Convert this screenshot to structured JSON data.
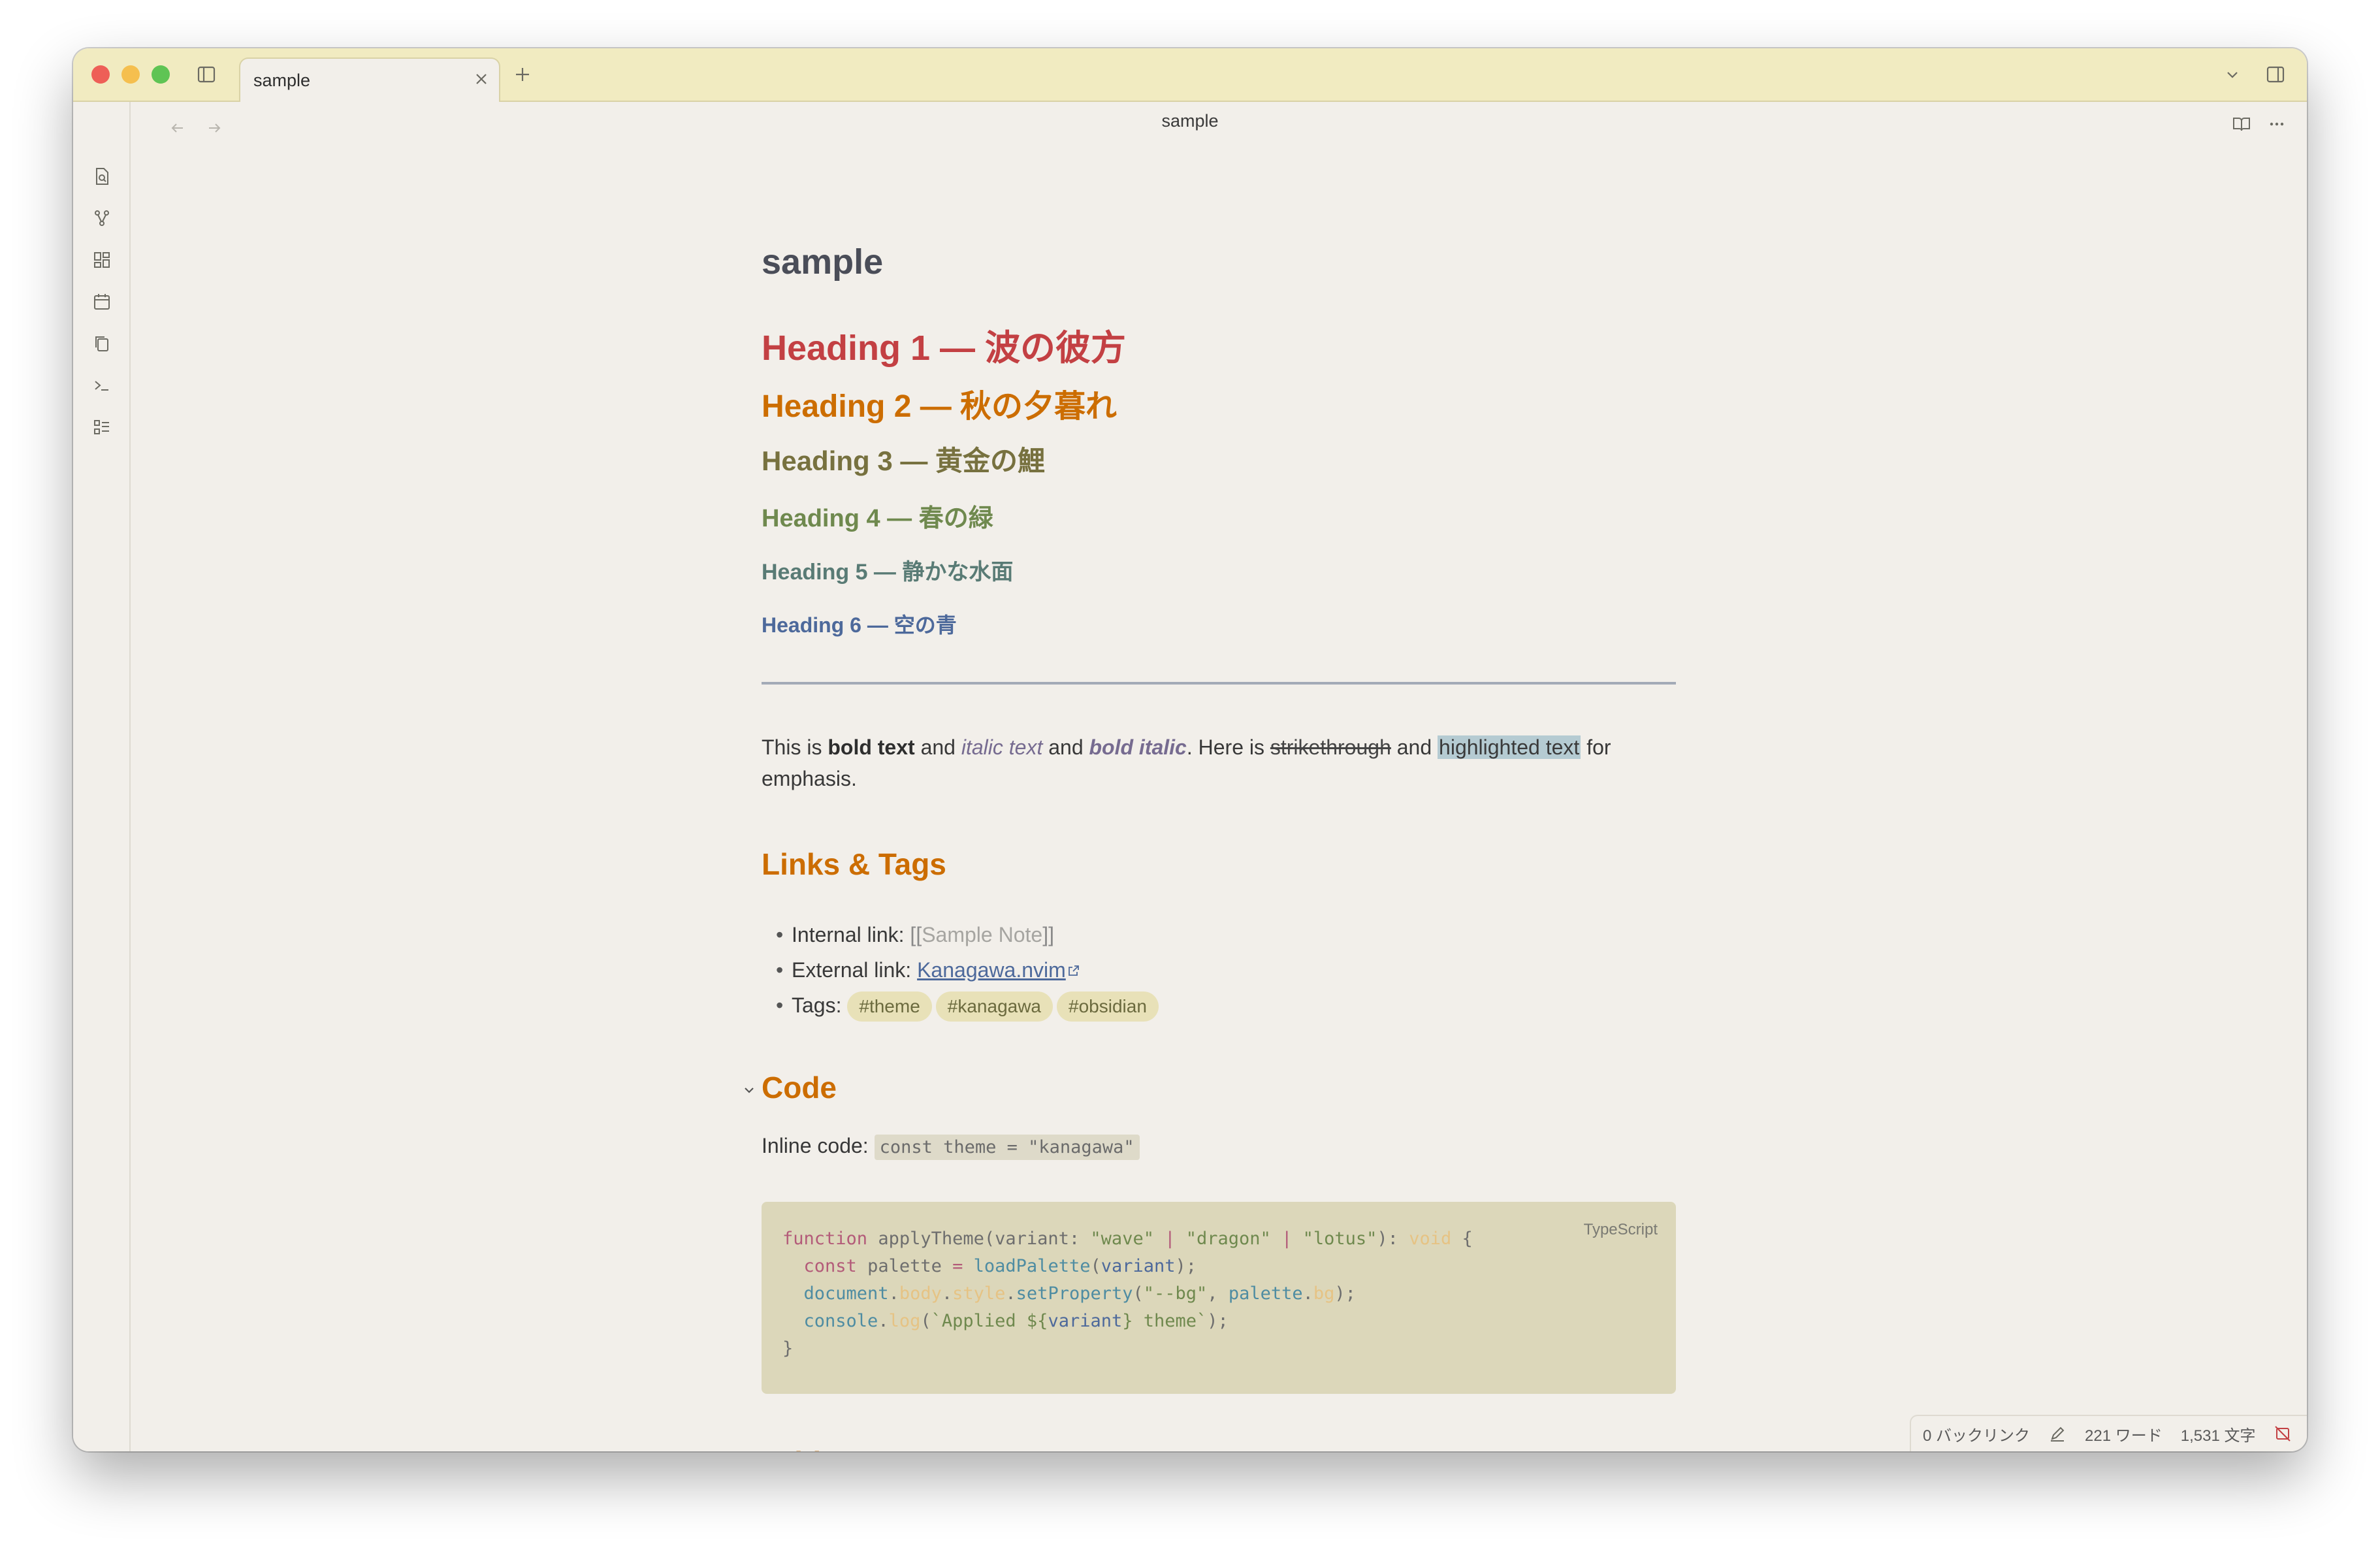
{
  "tabbar": {
    "tab_label": "sample"
  },
  "header": {
    "title": "sample"
  },
  "note": {
    "inline_title": "sample",
    "headings": [
      "Heading 1 — 波の彼方",
      "Heading 2 — 秋の夕暮れ",
      "Heading 3 — 黄金の鯉",
      "Heading 4 — 春の緑",
      "Heading 5 — 静かな水面",
      "Heading 6 — 空の青"
    ],
    "paragraph": {
      "p1": "This is ",
      "bold": "bold text",
      "p2": " and ",
      "italic": "italic text",
      "p3": " and ",
      "bold_italic": "bold italic",
      "p4": ". Here is ",
      "strike": "strikethrough",
      "p5": " and ",
      "highlight": "highlighted text",
      "p6": " for emphasis."
    },
    "links_heading": "Links & Tags",
    "links": {
      "internal_label": "Internal link: ",
      "internal_open": "[[",
      "internal_target": "Sample Note",
      "internal_close": "]]",
      "external_label": "External link: ",
      "external_text": "Kanagawa.nvim",
      "tags_label": "Tags: ",
      "tags": [
        "#theme",
        "#kanagawa",
        "#obsidian"
      ]
    },
    "code_heading": "Code",
    "inline_code_label": "Inline code: ",
    "inline_code": "const theme = \"kanagawa\"",
    "code_block": {
      "language": "TypeScript",
      "lines": [
        "function applyTheme(variant: \"wave\" | \"dragon\" | \"lotus\"): void {",
        "  const palette = loadPalette(variant);",
        "  document.body.style.setProperty(\"--bg\", palette.bg);",
        "  console.log(`Applied ${variant} theme`);",
        "}"
      ]
    },
    "table_heading": "Table"
  },
  "statusbar": {
    "backlinks": "0 バックリンク",
    "words": "221 ワード",
    "chars": "1,531 文字"
  },
  "colors": {
    "tabbar_bg": "#f1ebc1",
    "page_bg": "#f2efea",
    "heading_accent": "#cc6d00",
    "code_bg": "#dcd7ba"
  }
}
